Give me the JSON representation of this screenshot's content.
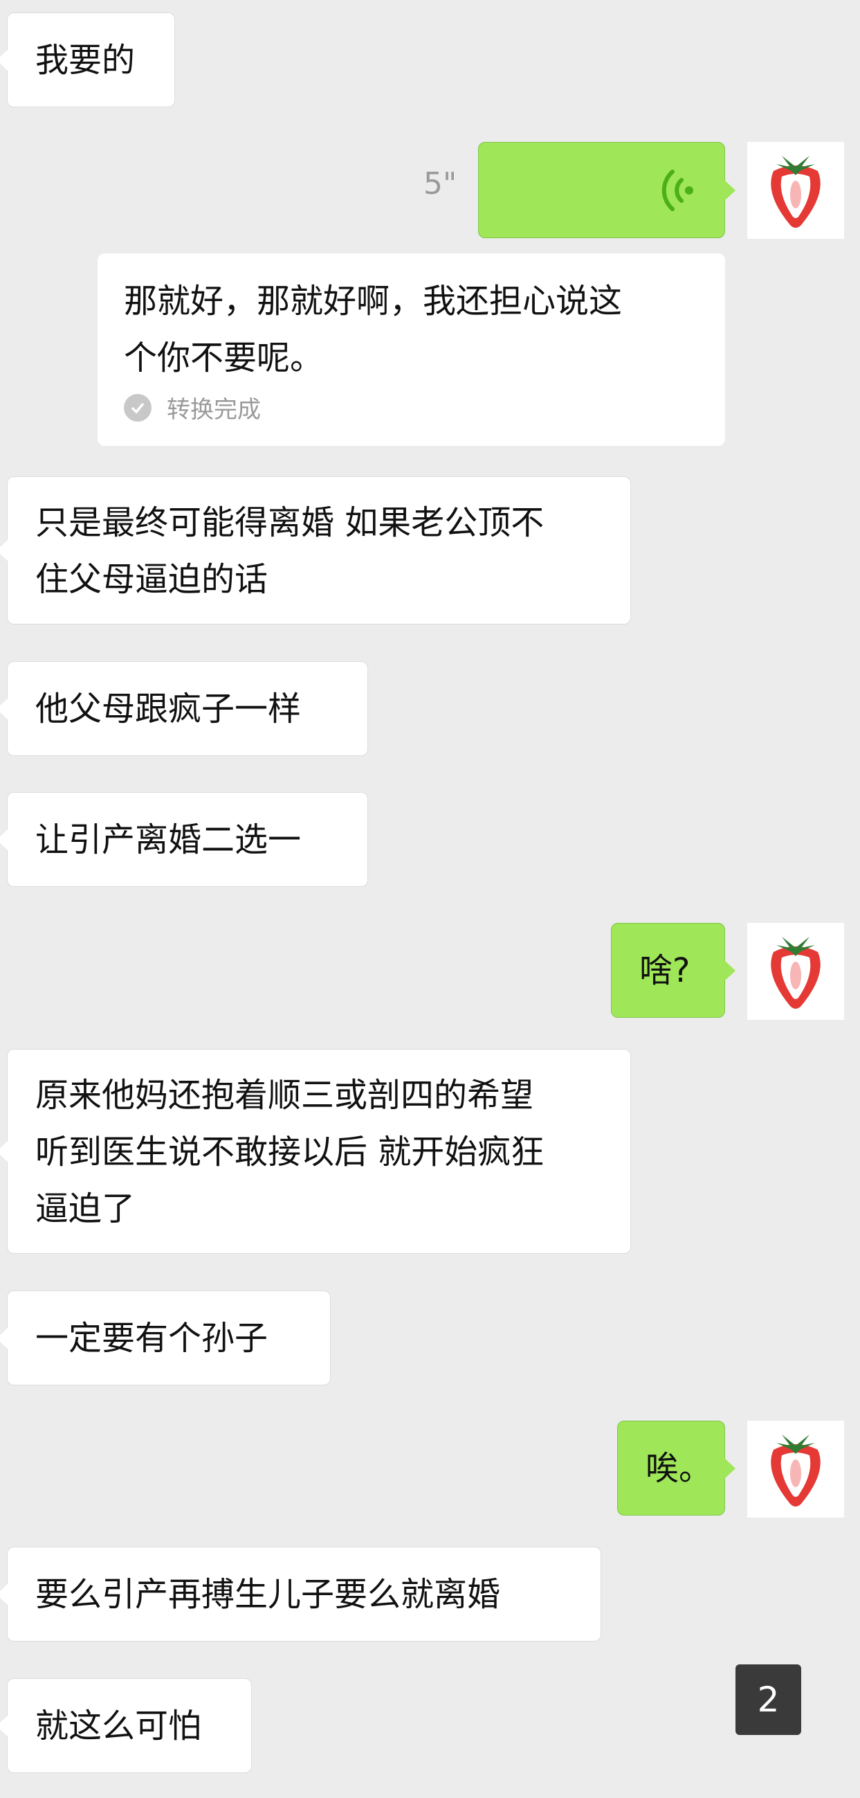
{
  "messages": [
    {
      "side": "left",
      "lines": [
        "我要的"
      ]
    },
    {
      "side": "right",
      "type": "voice",
      "duration": "5\""
    },
    {
      "type": "conversion",
      "lines": [
        "那就好，那就好啊，我还担心说这",
        "个你不要呢。"
      ],
      "status": "转换完成"
    },
    {
      "side": "left",
      "lines": [
        "只是最终可能得离婚 如果老公顶不",
        "住父母逼迫的话"
      ]
    },
    {
      "side": "left",
      "lines": [
        "他父母跟疯子一样"
      ]
    },
    {
      "side": "left",
      "lines": [
        "让引产离婚二选一"
      ]
    },
    {
      "side": "right",
      "lines": [
        "啥?"
      ]
    },
    {
      "side": "left",
      "lines": [
        "原来他妈还抱着顺三或剖四的希望",
        "听到医生说不敢接以后 就开始疯狂",
        "逼迫了"
      ]
    },
    {
      "side": "left",
      "lines": [
        "一定要有个孙子"
      ]
    },
    {
      "side": "right",
      "lines": [
        "唉。"
      ]
    },
    {
      "side": "left",
      "lines": [
        "要么引产再搏生儿子要么就离婚"
      ]
    },
    {
      "side": "left",
      "lines": [
        "就这么可怕"
      ]
    }
  ],
  "badge": {
    "count": "2"
  },
  "colors": {
    "background": "#ececec",
    "sent_bubble": "#9fe658",
    "received_bubble": "#ffffff",
    "voice_wave": "#4caf1a",
    "strawberry": "#e53935"
  },
  "icons": {
    "avatar": "strawberry-avatar-icon",
    "voice": "voice-wave-icon",
    "check": "check-circle-icon"
  }
}
